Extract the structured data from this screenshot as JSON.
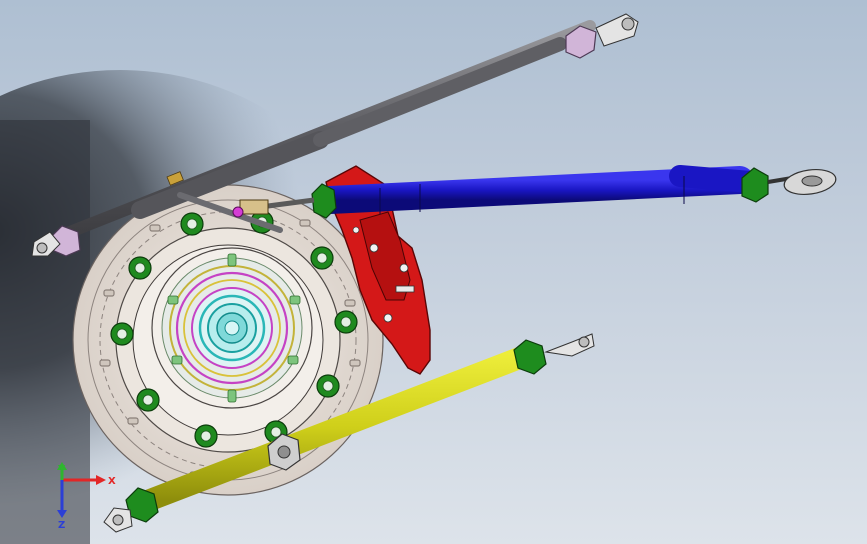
{
  "app": {
    "window": "3d-model-viewport"
  },
  "triad": {
    "x_label": "X",
    "y_label": "Y",
    "z_label": "Z",
    "x_color": "#e32626",
    "y_color": "#2fb52f",
    "z_color": "#2c3fd6"
  },
  "model": {
    "components": [
      "wheel-hub-assembly",
      "brake-caliper",
      "upper-gray-link",
      "blue-toe-link",
      "yellow-lower-link"
    ],
    "colors": {
      "gray_link": "#6f6f73",
      "blue_link": "#1a16c4",
      "yellow_link": "#cfcf1a",
      "caliper": "#d41818",
      "nut": "#1e8c1e",
      "rod_end": "#d6d6d6"
    }
  }
}
